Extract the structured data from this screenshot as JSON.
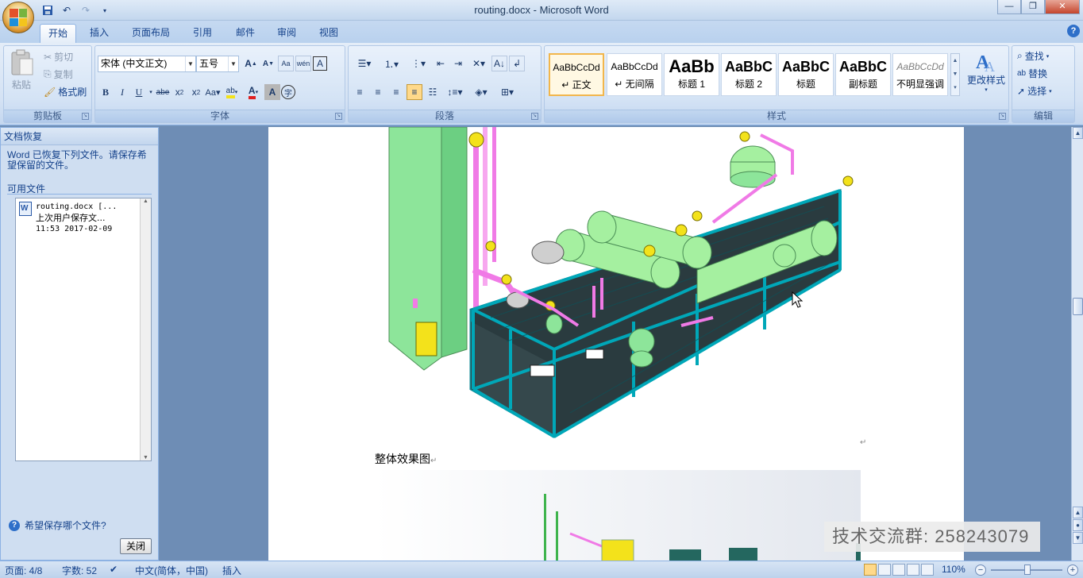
{
  "window": {
    "title": "routing.docx - Microsoft Word"
  },
  "tabs": [
    "开始",
    "插入",
    "页面布局",
    "引用",
    "邮件",
    "审阅",
    "视图"
  ],
  "clipboard": {
    "paste": "粘贴",
    "cut": "剪切",
    "copy": "复制",
    "format_painter": "格式刷",
    "label": "剪贴板"
  },
  "font": {
    "name": "宋体 (中文正文)",
    "size": "五号",
    "label": "字体"
  },
  "paragraph": {
    "label": "段落"
  },
  "styles": {
    "label": "样式",
    "items": [
      {
        "sample": "AaBbCcDd",
        "name": "↵ 正文"
      },
      {
        "sample": "AaBbCcDd",
        "name": "↵ 无间隔"
      },
      {
        "sample": "AaBb",
        "name": "标题 1"
      },
      {
        "sample": "AaBbC",
        "name": "标题 2"
      },
      {
        "sample": "AaBbC",
        "name": "标题"
      },
      {
        "sample": "AaBbC",
        "name": "副标题"
      },
      {
        "sample": "AaBbCcDd",
        "name": "不明显强调"
      }
    ],
    "change_styles": "更改样式"
  },
  "editing": {
    "find": "查找",
    "replace": "替换",
    "select": "选择",
    "label": "编辑"
  },
  "taskpane": {
    "title": "文档恢复",
    "description": "Word 已恢复下列文件。请保存希望保留的文件。",
    "available_label": "可用文件",
    "file": {
      "name": "routing.docx  [...",
      "status": "上次用户保存文...",
      "time": "11:53 2017-02-09"
    },
    "help_link": "希望保存哪个文件?",
    "close_button": "关闭"
  },
  "document": {
    "caption": "整体效果图"
  },
  "watermark": "技术交流群: 258243079",
  "status": {
    "page": "页面: 4/8",
    "words": "字数: 52",
    "language": "中文(简体，中国)",
    "mode": "插入",
    "zoom": "110%"
  },
  "colors": {
    "accent": "#15428b",
    "ribbon": "#d4e2f4",
    "frame": "#00bfd0",
    "equipment": "#a5f0a0",
    "pipe": "#f07ae6",
    "yellow": "#f3e21b"
  }
}
